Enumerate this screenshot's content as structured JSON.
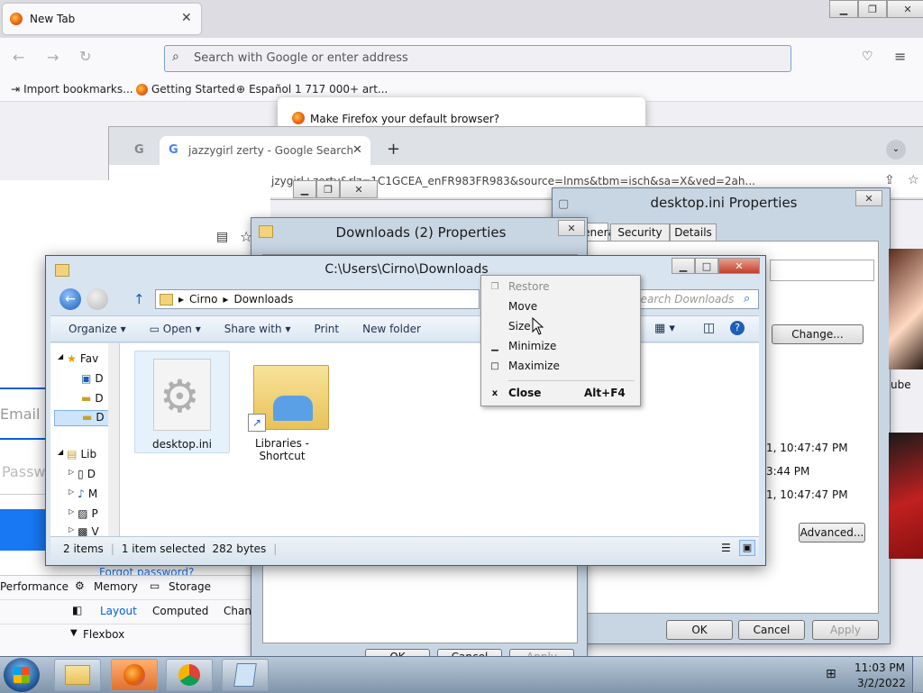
{
  "firefox": {
    "tab_title": "New Tab",
    "url_placeholder": "Search with Google or enter address",
    "bookmarks": [
      "Import bookmarks...",
      "Getting Started",
      "Español 1 717 000+ art..."
    ],
    "default_browser_prompt": "Make Firefox your default browser?"
  },
  "chrome": {
    "tab_title": "jazzygirl zerty - Google Search",
    "url_fragment": "jzygirl+zerty&rlz=1C1GCEA_enFR983FR983&source=lnms&tbm=isch&sa=X&ved=2ah..."
  },
  "devtools": {
    "tabs": [
      "Performance",
      "Memory",
      "Storage"
    ],
    "subtabs": [
      "Layout",
      "Computed",
      "Chang"
    ],
    "section": "Flexbox"
  },
  "login": {
    "email_placeholder": "Email",
    "password_placeholder": "Passw",
    "forgot": "Forgot password?"
  },
  "downloads_props": {
    "title": "Downloads (2) Properties",
    "ok": "OK",
    "cancel": "Cancel",
    "apply": "Apply"
  },
  "ini_props": {
    "title": "desktop.ini Properties",
    "tabs": [
      "General",
      "Security",
      "Details"
    ],
    "change_button": "Change...",
    "advanced_button": "Advanced...",
    "dates": [
      "1, 10:47:47 PM",
      "3:44 PM",
      "1, 10:47:47 PM"
    ],
    "ok": "OK",
    "cancel": "Cancel",
    "apply": "Apply"
  },
  "side_thumb_label": "ube",
  "explorer": {
    "title": "C:\\Users\\Cirno\\Downloads",
    "breadcrumb": [
      "Cirno",
      "Downloads"
    ],
    "search_placeholder": "Search Downloads",
    "commands": [
      "Organize",
      "Open",
      "Share with",
      "Print",
      "New folder"
    ],
    "tree": [
      "Fav",
      "D",
      "D",
      "D",
      "Lib",
      "D",
      "M",
      "P",
      "V"
    ],
    "files": [
      {
        "name": "desktop.ini",
        "icon": "gear-file-icon"
      },
      {
        "name": "Libraries -\nShortcut",
        "icon": "libraries-folder-icon"
      }
    ],
    "status_items": "2 items",
    "status_selected": "1 item selected  282 bytes"
  },
  "context_menu": {
    "items": [
      {
        "label": "Restore",
        "glyph": "❐",
        "disabled": true
      },
      {
        "label": "Move",
        "glyph": "",
        "disabled": false
      },
      {
        "label": "Size",
        "glyph": "",
        "disabled": false
      },
      {
        "label": "Minimize",
        "glyph": "▁",
        "disabled": false
      },
      {
        "label": "Maximize",
        "glyph": "□",
        "disabled": false
      },
      {
        "label": "Close",
        "glyph": "x",
        "shortcut": "Alt+F4",
        "bold": true
      }
    ]
  },
  "taskbar": {
    "time": "11:03 PM",
    "date": "3/2/2022"
  },
  "colors": {
    "taskbar": "#7f94aa",
    "explorer_frame": "#d8e4f0",
    "firefox_accent": "#e66000"
  }
}
